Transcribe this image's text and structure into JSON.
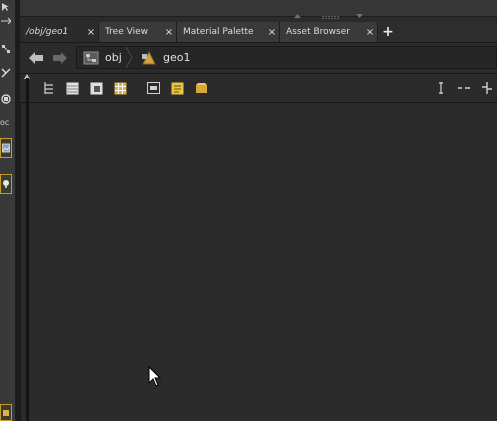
{
  "tabs": [
    {
      "label": "/obj/geo1",
      "close": "×",
      "active": true
    },
    {
      "label": "Tree View",
      "close": "×",
      "active": false
    },
    {
      "label": "Material Palette",
      "close": "×",
      "active": false
    },
    {
      "label": "Asset Browser",
      "close": "×",
      "active": false
    }
  ],
  "tab_add_label": "+",
  "path": {
    "crumb1": "obj",
    "crumb2": "geo1"
  },
  "shelf": {
    "text_label": "oc"
  },
  "colors": {
    "accent": "#c59c2e",
    "background": "#2b2b2b"
  }
}
